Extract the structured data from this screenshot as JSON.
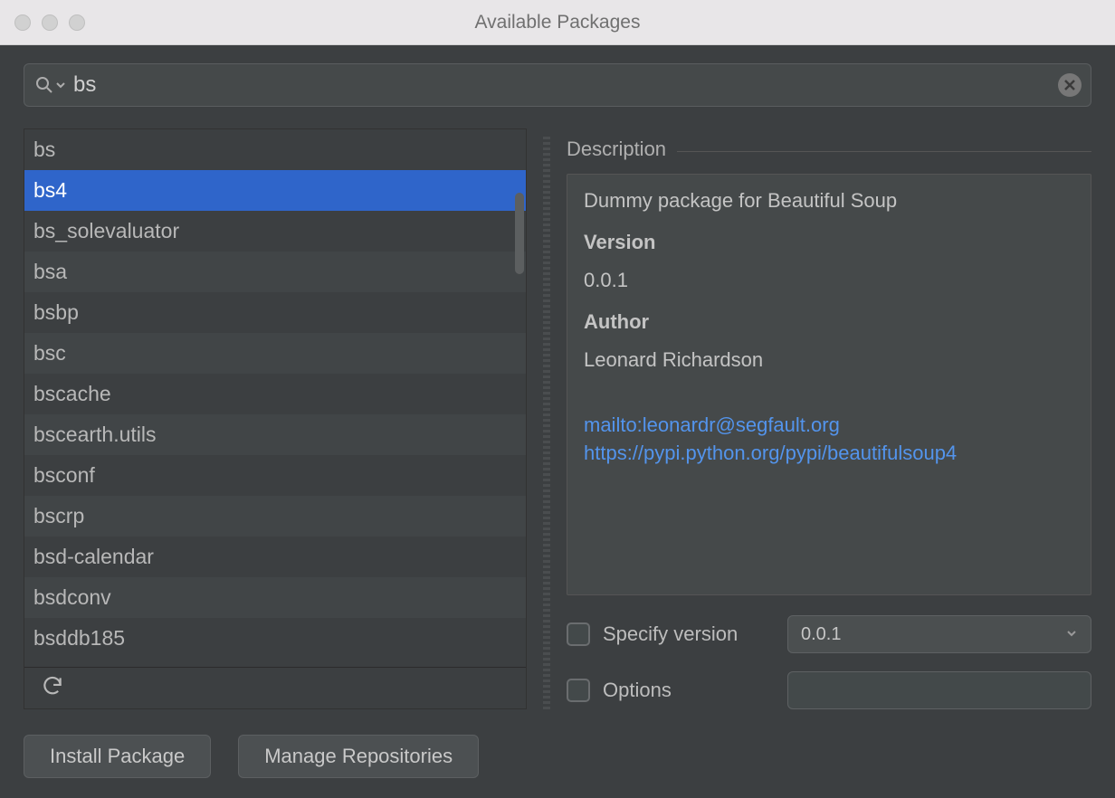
{
  "window": {
    "title": "Available Packages"
  },
  "search": {
    "value": "bs"
  },
  "packages": [
    {
      "name": "bs"
    },
    {
      "name": "bs4",
      "selected": true
    },
    {
      "name": "bs_solevaluator"
    },
    {
      "name": "bsa"
    },
    {
      "name": "bsbp"
    },
    {
      "name": "bsc"
    },
    {
      "name": "bscache"
    },
    {
      "name": "bscearth.utils"
    },
    {
      "name": "bsconf"
    },
    {
      "name": "bscrp"
    },
    {
      "name": "bsd-calendar"
    },
    {
      "name": "bsdconv"
    },
    {
      "name": "bsddb185"
    }
  ],
  "description": {
    "heading": "Description",
    "summary": "Dummy package for Beautiful Soup",
    "version_label": "Version",
    "version": "0.0.1",
    "author_label": "Author",
    "author": "Leonard Richardson",
    "links": {
      "mailto": "mailto:leonardr@segfault.org",
      "homepage": "https://pypi.python.org/pypi/beautifulsoup4"
    }
  },
  "options": {
    "specify_version_label": "Specify version",
    "specify_version_value": "0.0.1",
    "options_label": "Options"
  },
  "buttons": {
    "install": "Install Package",
    "manage_repos": "Manage Repositories"
  }
}
